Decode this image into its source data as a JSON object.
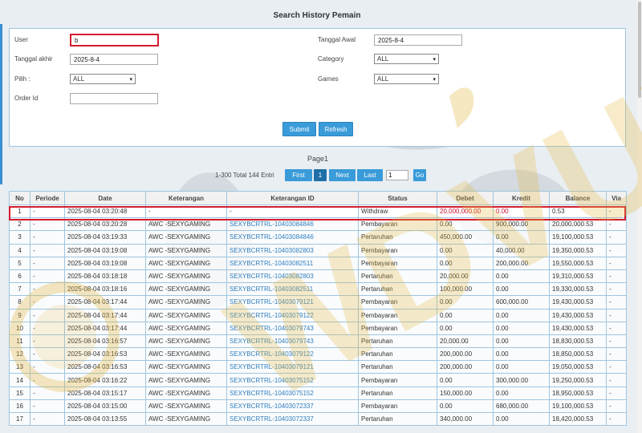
{
  "title": "Search History Pemain",
  "form": {
    "user_label": "User",
    "user_value": "b",
    "tanggal_akhir_label": "Tanggal akhir",
    "tanggal_akhir_value": "2025-8-4",
    "pilih_label": "Pilih :",
    "pilih_value": "ALL",
    "order_id_label": "Order Id",
    "order_id_value": "",
    "tanggal_awal_label": "Tanggal Awal",
    "tanggal_awal_value": "2025-8-4",
    "category_label": "Category",
    "category_value": "ALL",
    "games_label": "Games",
    "games_value": "ALL",
    "submit_label": "Submit",
    "refresh_label": "Refresh"
  },
  "pager": {
    "page_text": "Page1",
    "info": "1-300 Total 144 Entri",
    "first": "First",
    "current": "1",
    "next": "Next",
    "last": "Last",
    "input_value": "1",
    "go": "Go"
  },
  "table": {
    "headers": [
      "No",
      "Periode",
      "Date",
      "Keterangan",
      "Keterangan ID",
      "Status",
      "Debet",
      "Kredit",
      "Balance",
      "Via"
    ],
    "rows": [
      {
        "no": "1",
        "periode": "-",
        "date": "2025-08-04 03:20:48",
        "ket": "-",
        "ket_id": "-",
        "status": "Withdraw",
        "debet": "20,000,000.00",
        "kredit": "0.00",
        "balance": "0.53",
        "via": "-"
      },
      {
        "no": "2",
        "periode": "-",
        "date": "2025-08-04 03:20:28",
        "ket": "AWC -SEXYGAMING",
        "ket_id": "SEXYBCRTRL-10403084846",
        "status": "Pembayaran",
        "debet": "0.00",
        "kredit": "900,000.00",
        "balance": "20,000,000.53",
        "via": "-"
      },
      {
        "no": "3",
        "periode": "-",
        "date": "2025-08-04 03:19:33",
        "ket": "AWC -SEXYGAMING",
        "ket_id": "SEXYBCRTRL-10403084846",
        "status": "Pertaruhan",
        "debet": "450,000.00",
        "kredit": "0.00",
        "balance": "19,100,000.53",
        "via": "-"
      },
      {
        "no": "4",
        "periode": "-",
        "date": "2025-08-04 03:19:08",
        "ket": "AWC -SEXYGAMING",
        "ket_id": "SEXYBCRTRL-10403082803",
        "status": "Pembayaran",
        "debet": "0.00",
        "kredit": "40,000.00",
        "balance": "19,350,000.53",
        "via": "-"
      },
      {
        "no": "5",
        "periode": "-",
        "date": "2025-08-04 03:19:08",
        "ket": "AWC -SEXYGAMING",
        "ket_id": "SEXYBCRTRL-10403082511",
        "status": "Pembayaran",
        "debet": "0.00",
        "kredit": "200,000.00",
        "balance": "19,550,000.53",
        "via": "-"
      },
      {
        "no": "6",
        "periode": "-",
        "date": "2025-08-04 03:18:18",
        "ket": "AWC -SEXYGAMING",
        "ket_id": "SEXYBCRTRL-10403082803",
        "status": "Pertaruhan",
        "debet": "20,000.00",
        "kredit": "0.00",
        "balance": "19,310,000.53",
        "via": "-"
      },
      {
        "no": "7",
        "periode": "-",
        "date": "2025-08-04 03:18:16",
        "ket": "AWC -SEXYGAMING",
        "ket_id": "SEXYBCRTRL-10403082511",
        "status": "Pertaruhan",
        "debet": "100,000.00",
        "kredit": "0.00",
        "balance": "19,330,000.53",
        "via": "-"
      },
      {
        "no": "8",
        "periode": "-",
        "date": "2025-08-04 03:17:44",
        "ket": "AWC -SEXYGAMING",
        "ket_id": "SEXYBCRTRL-10403079121",
        "status": "Pembayaran",
        "debet": "0.00",
        "kredit": "600,000.00",
        "balance": "19,430,000.53",
        "via": "-"
      },
      {
        "no": "9",
        "periode": "-",
        "date": "2025-08-04 03:17:44",
        "ket": "AWC -SEXYGAMING",
        "ket_id": "SEXYBCRTRL-10403079122",
        "status": "Pembayaran",
        "debet": "0.00",
        "kredit": "0.00",
        "balance": "19,430,000.53",
        "via": "-"
      },
      {
        "no": "10",
        "periode": "-",
        "date": "2025-08-04 03:17:44",
        "ket": "AWC -SEXYGAMING",
        "ket_id": "SEXYBCRTRL-10403079743",
        "status": "Pembayaran",
        "debet": "0.00",
        "kredit": "0.00",
        "balance": "19,430,000.53",
        "via": "-"
      },
      {
        "no": "11",
        "periode": "-",
        "date": "2025-08-04 03:16:57",
        "ket": "AWC -SEXYGAMING",
        "ket_id": "SEXYBCRTRL-10403079743",
        "status": "Pertaruhan",
        "debet": "20,000.00",
        "kredit": "0.00",
        "balance": "18,830,000.53",
        "via": "-"
      },
      {
        "no": "12",
        "periode": "-",
        "date": "2025-08-04 03:16:53",
        "ket": "AWC -SEXYGAMING",
        "ket_id": "SEXYBCRTRL-10403079122",
        "status": "Pertaruhan",
        "debet": "200,000.00",
        "kredit": "0.00",
        "balance": "18,850,000.53",
        "via": "-"
      },
      {
        "no": "13",
        "periode": "-",
        "date": "2025-08-04 03:16:53",
        "ket": "AWC -SEXYGAMING",
        "ket_id": "SEXYBCRTRL-10403079121",
        "status": "Pertaruhan",
        "debet": "200,000.00",
        "kredit": "0.00",
        "balance": "19,050,000.53",
        "via": "-"
      },
      {
        "no": "14",
        "periode": "-",
        "date": "2025-08-04 03:16:22",
        "ket": "AWC -SEXYGAMING",
        "ket_id": "SEXYBCRTRL-10403075152",
        "status": "Pembayaran",
        "debet": "0.00",
        "kredit": "300,000.00",
        "balance": "19,250,000.53",
        "via": "-"
      },
      {
        "no": "15",
        "periode": "-",
        "date": "2025-08-04 03:15:17",
        "ket": "AWC -SEXYGAMING",
        "ket_id": "SEXYBCRTRL-10403075152",
        "status": "Pertaruhan",
        "debet": "150,000.00",
        "kredit": "0.00",
        "balance": "18,950,000.53",
        "via": "-"
      },
      {
        "no": "16",
        "periode": "-",
        "date": "2025-08-04 03:15:00",
        "ket": "AWC -SEXYGAMING",
        "ket_id": "SEXYBCRTRL-10403072337",
        "status": "Pembayaran",
        "debet": "0.00",
        "kredit": "680,000.00",
        "balance": "19,100,000.53",
        "via": "-"
      },
      {
        "no": "17",
        "periode": "-",
        "date": "2025-08-04 03:13:55",
        "ket": "AWC -SEXYGAMING",
        "ket_id": "SEXYBCRTRL-10403072337",
        "status": "Pertaruhan",
        "debet": "340,000.00",
        "kredit": "0.00",
        "balance": "18,420,000.53",
        "via": "-"
      }
    ]
  },
  "watermark_text": "WDVUK",
  "colors": {
    "accent": "#3a9bd9",
    "highlight": "#d41c2d",
    "link": "#2f7fc0",
    "watermark_gold": "#e0b640"
  }
}
